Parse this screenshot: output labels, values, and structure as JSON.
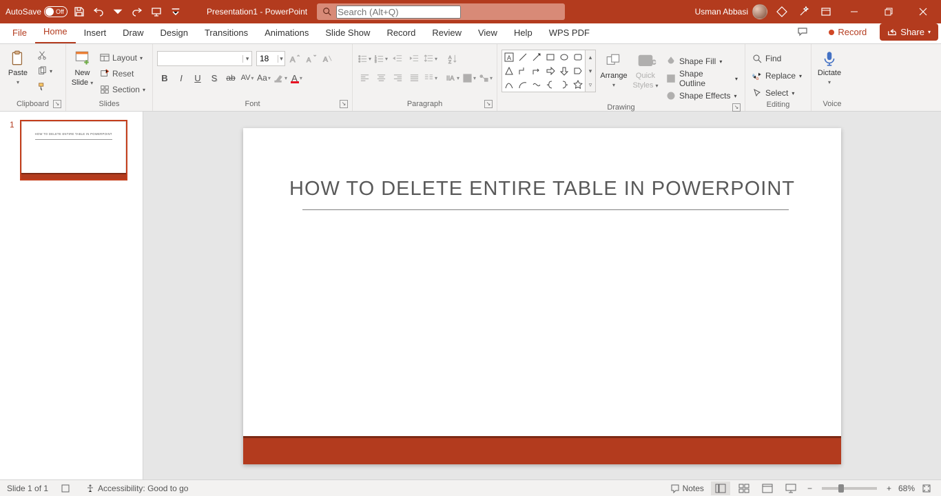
{
  "titlebar": {
    "autosave_label": "AutoSave",
    "autosave_state": "Off",
    "doc_title": "Presentation1  -  PowerPoint",
    "search_placeholder": "Search (Alt+Q)",
    "user_name": "Usman Abbasi"
  },
  "tabs": {
    "file": "File",
    "home": "Home",
    "insert": "Insert",
    "draw": "Draw",
    "design": "Design",
    "transitions": "Transitions",
    "animations": "Animations",
    "slideshow": "Slide Show",
    "record_tab": "Record",
    "review": "Review",
    "view": "View",
    "help": "Help",
    "wps": "WPS PDF",
    "record_btn": "Record",
    "share_btn": "Share"
  },
  "ribbon": {
    "clipboard": {
      "label": "Clipboard",
      "paste": "Paste"
    },
    "slides": {
      "label": "Slides",
      "new_slide_l1": "New",
      "new_slide_l2": "Slide",
      "layout": "Layout",
      "reset": "Reset",
      "section": "Section"
    },
    "font": {
      "label": "Font",
      "size": "18"
    },
    "paragraph": {
      "label": "Paragraph"
    },
    "drawing": {
      "label": "Drawing",
      "arrange": "Arrange",
      "quick_l1": "Quick",
      "quick_l2": "Styles",
      "fill": "Shape Fill",
      "outline": "Shape Outline",
      "effects": "Shape Effects"
    },
    "editing": {
      "label": "Editing",
      "find": "Find",
      "replace": "Replace",
      "select": "Select"
    },
    "voice": {
      "label": "Voice",
      "dictate": "Dictate"
    }
  },
  "thumbs": {
    "n1": "1"
  },
  "slide": {
    "title": "HOW TO DELETE  ENTIRE TABLE IN POWERPOINT"
  },
  "status": {
    "slide_info": "Slide 1 of 1",
    "accessibility": "Accessibility: Good to go",
    "notes": "Notes",
    "zoom_pct": "68%"
  }
}
